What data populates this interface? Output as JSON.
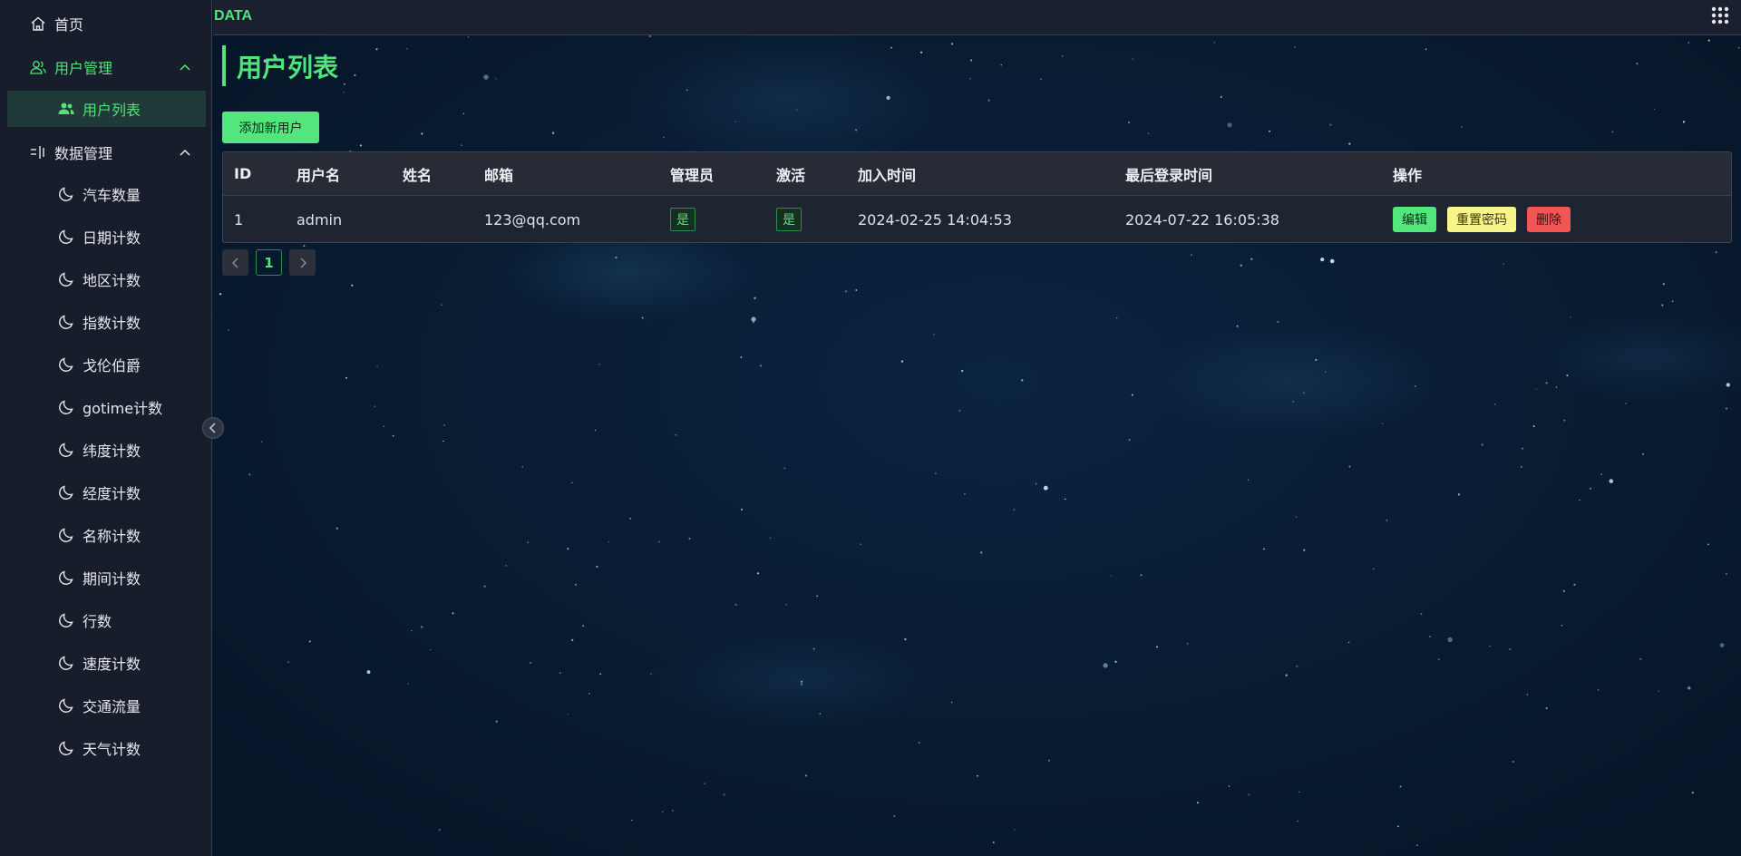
{
  "brand": "DATA",
  "sidebar": {
    "home": "首页",
    "user_mgmt": "用户管理",
    "user_list": "用户列表",
    "data_mgmt": "数据管理",
    "data_items": [
      "汽车数量",
      "日期计数",
      "地区计数",
      "指数计数",
      "戈伦伯爵",
      "gotime计数",
      "纬度计数",
      "经度计数",
      "名称计数",
      "期间计数",
      "行数",
      "速度计数",
      "交通流量",
      "天气计数"
    ]
  },
  "page": {
    "title": "用户列表",
    "add_button": "添加新用户"
  },
  "table": {
    "headers": [
      "ID",
      "用户名",
      "姓名",
      "邮箱",
      "管理员",
      "激活",
      "加入时间",
      "最后登录时间",
      "操作"
    ],
    "rows": [
      {
        "id": "1",
        "username": "admin",
        "name": "",
        "email": "123@qq.com",
        "admin": "是",
        "active": "是",
        "joined": "2024-02-25 14:04:53",
        "last_login": "2024-07-22 16:05:38",
        "actions": {
          "edit": "编辑",
          "reset": "重置密码",
          "delete": "删除"
        }
      }
    ]
  },
  "pagination": {
    "current": "1",
    "prev_icon": "chevron-left-icon",
    "next_icon": "chevron-right-icon"
  },
  "colors": {
    "accent": "#52e37a",
    "warning": "#f7f58a",
    "danger": "#f25555"
  }
}
